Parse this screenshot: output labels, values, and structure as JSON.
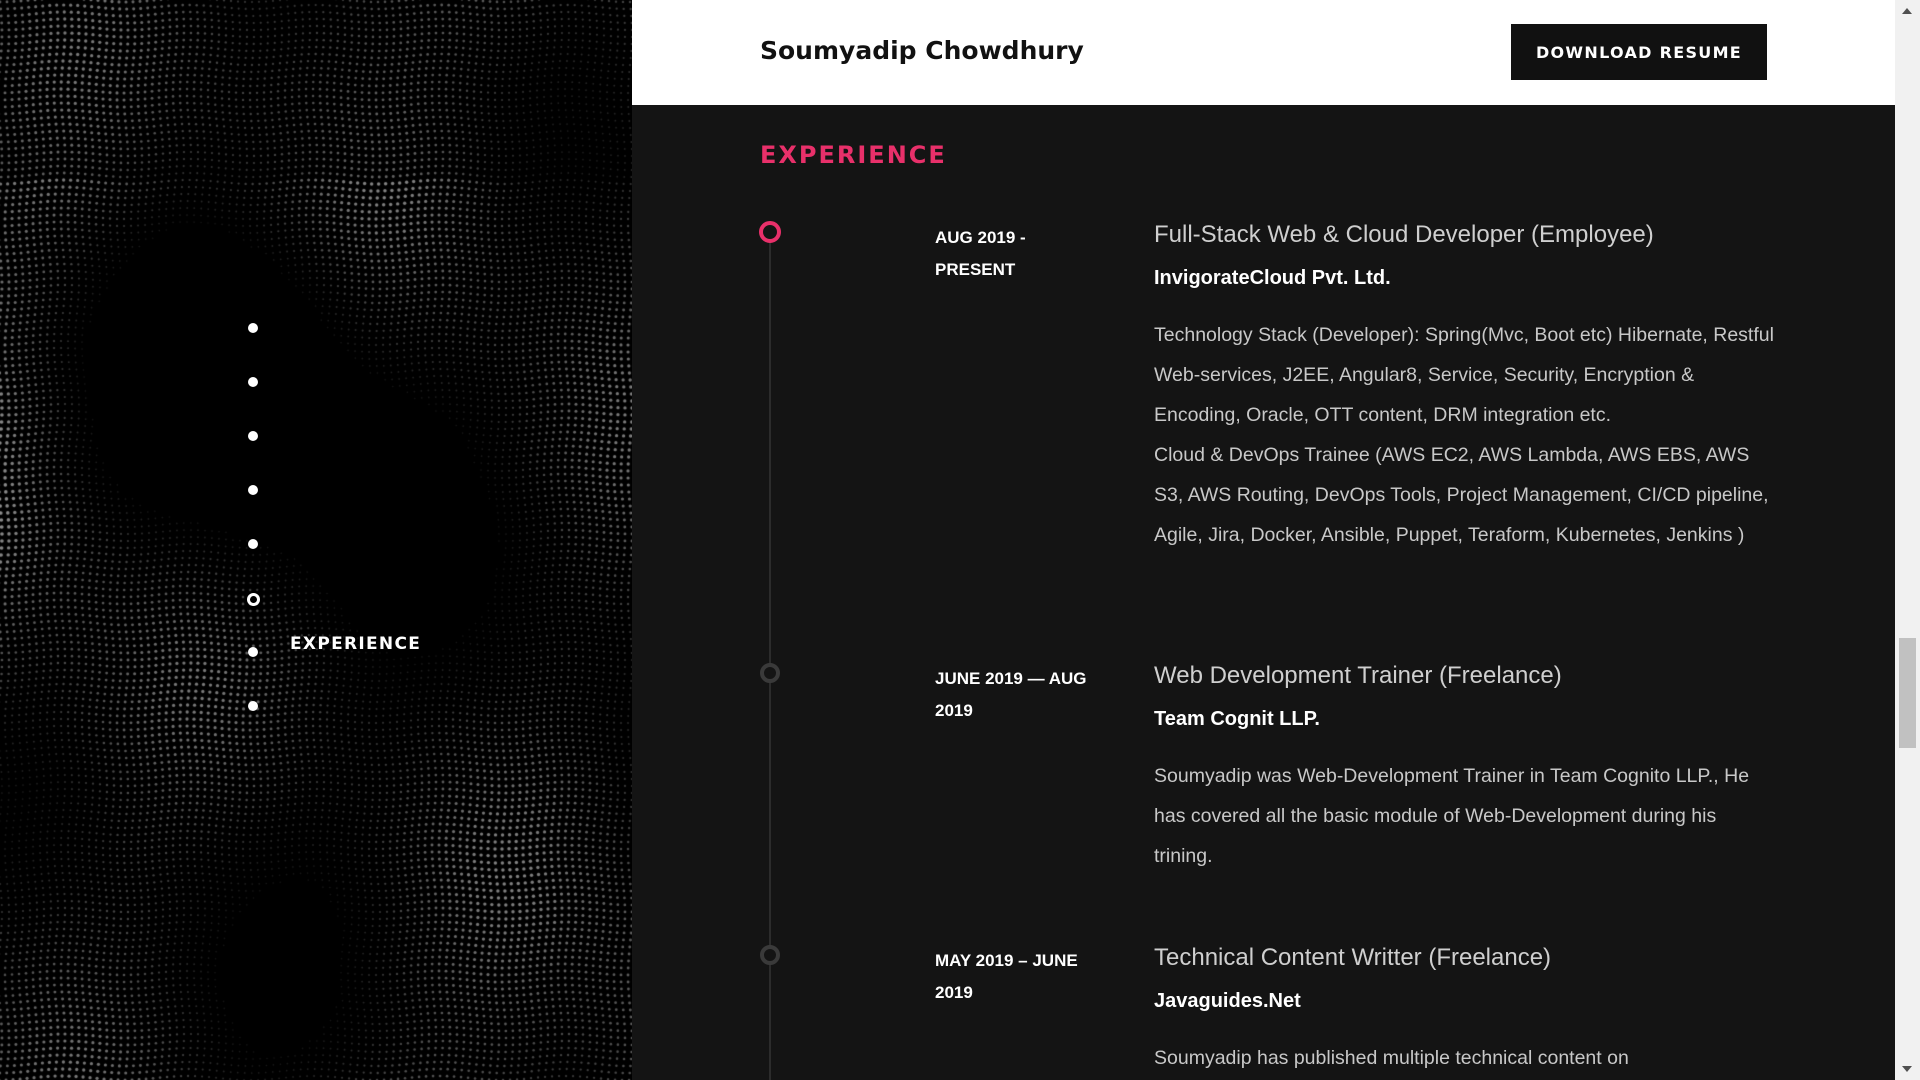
{
  "header": {
    "site_name": "Soumyadip Chowdhury",
    "download_label": "DOWNLOAD RESUME"
  },
  "side_nav": {
    "dot_count": 8,
    "active_index": 5,
    "label": "EXPERIENCE"
  },
  "section": {
    "title": "EXPERIENCE",
    "accent_color": "#e8306a"
  },
  "experience": [
    {
      "date": "AUG 2019 - PRESENT",
      "role": "Full-Stack Web & Cloud Developer (Employee)",
      "company": "InvigorateCloud Pvt. Ltd.",
      "description": "Technology Stack (Developer): Spring(Mvc, Boot etc) Hibernate, Restful Web-services, J2EE, Angular8, Service, Security, Encryption & Encoding, Oracle, OTT content, DRM integration etc.",
      "description2": "Cloud & DevOps Trainee (AWS EC2, AWS Lambda, AWS EBS, AWS S3, AWS Routing, DevOps Tools, Project Management, CI/CD pipeline, Agile, Jira, Docker, Ansible, Puppet, Teraform, Kubernetes, Jenkins )"
    },
    {
      "date": "JUNE 2019 — AUG 2019",
      "role": "Web Development Trainer (Freelance)",
      "company": "Team Cognit LLP.",
      "description": "Soumyadip was Web-Development Trainer in Team Cognito LLP., He has covered all the basic module of Web-Development during his trining."
    },
    {
      "date": "MAY 2019 – JUNE 2019",
      "role": "Technical Content Writter (Freelance)",
      "company": "Javaguides.Net",
      "description": "Soumyadip has published multiple technical content on"
    }
  ]
}
